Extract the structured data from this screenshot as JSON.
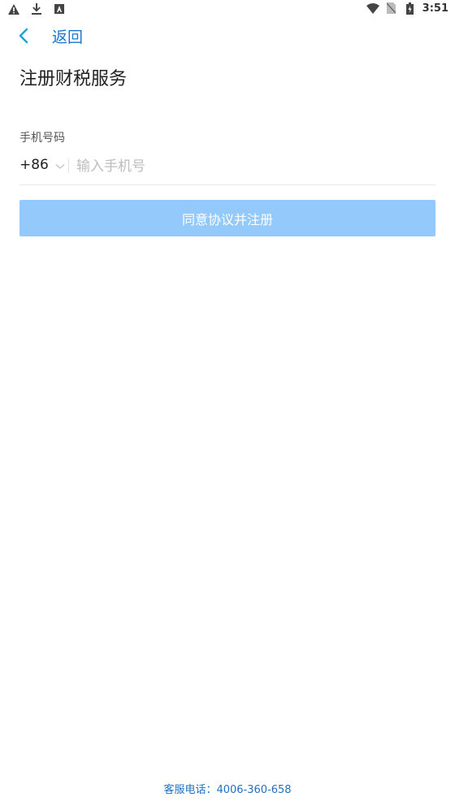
{
  "status_bar": {
    "time": "3:51",
    "left_icons": [
      "warning-icon",
      "download-icon",
      "a-box-icon"
    ],
    "right_icons": [
      "wifi-icon",
      "no-sim-icon",
      "battery-icon"
    ]
  },
  "nav": {
    "back_label": "返回"
  },
  "page": {
    "title": "注册财税服务"
  },
  "form": {
    "phone_label": "手机号码",
    "country_code": "+86",
    "phone_value": "",
    "phone_placeholder": "输入手机号"
  },
  "button": {
    "register_label": "同意协议并注册"
  },
  "footer": {
    "service_phone": "客服电话：4006-360-658"
  },
  "colors": {
    "accent": "#1976d2",
    "button_disabled": "#93c9fb",
    "footer_link": "#1e6fc2"
  }
}
